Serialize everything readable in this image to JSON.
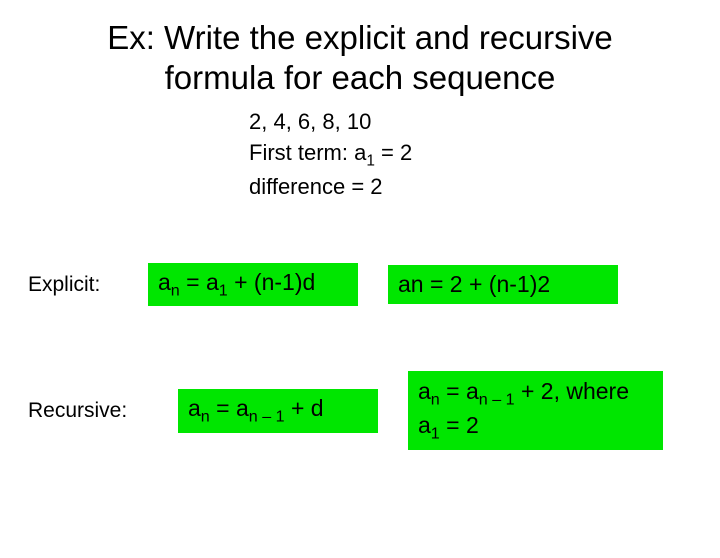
{
  "title": {
    "line1": "Ex: Write the explicit and recursive",
    "line2": "formula for each sequence"
  },
  "sequence": {
    "terms": "2, 4, 6, 8, 10",
    "first_term_label": "First term: a",
    "first_term_sub": "1",
    "first_term_value": " = 2",
    "difference": "difference = 2"
  },
  "explicit": {
    "label": "Explicit:",
    "general": {
      "pre": "a",
      "sub1": "n",
      "mid1": " = a",
      "sub2": "1",
      "post": " + (n-1)d"
    },
    "specific": "an = 2 + (n-1)2"
  },
  "recursive": {
    "label": "Recursive:",
    "general": {
      "pre": "a",
      "sub1": "n",
      "mid1": " = a",
      "sub2": "n – 1",
      "post": " + d"
    },
    "specific": {
      "pre": "a",
      "sub1": "n",
      "mid1": " = a",
      "sub2": "n – 1",
      "mid2": " + 2, where",
      "line2pre": "a",
      "sub3": "1",
      "line2post": " = 2"
    }
  }
}
